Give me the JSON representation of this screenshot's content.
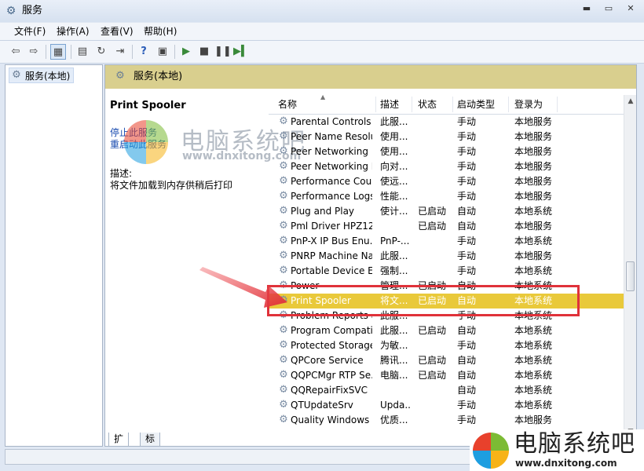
{
  "window": {
    "title": "服务"
  },
  "menu": [
    {
      "label": "文件(F)"
    },
    {
      "label": "操作(A)"
    },
    {
      "label": "查看(V)"
    },
    {
      "label": "帮助(H)"
    }
  ],
  "tree": {
    "root_label": "服务(本地)"
  },
  "panel": {
    "header_title": "服务(本地)"
  },
  "detail": {
    "service_name": "Print Spooler",
    "stop_link": "停止此服务",
    "restart_link": "重启动此服务",
    "description_label": "描述:",
    "description_text": "将文件加载到内存供稍后打印"
  },
  "table": {
    "columns": [
      "名称",
      "描述",
      "状态",
      "启动类型",
      "登录为"
    ],
    "rows": [
      [
        "Parental Controls",
        "此服...",
        "",
        "手动",
        "本地服务"
      ],
      [
        "Peer Name Resolu...",
        "使用...",
        "",
        "手动",
        "本地服务"
      ],
      [
        "Peer Networking ...",
        "使用...",
        "",
        "手动",
        "本地服务"
      ],
      [
        "Peer Networking I...",
        "向对...",
        "",
        "手动",
        "本地服务"
      ],
      [
        "Performance Cou...",
        "使远...",
        "",
        "手动",
        "本地服务"
      ],
      [
        "Performance Logs...",
        "性能...",
        "",
        "手动",
        "本地服务"
      ],
      [
        "Plug and Play",
        "使计...",
        "已启动",
        "自动",
        "本地系统"
      ],
      [
        "Pml Driver HPZ12",
        "",
        "已启动",
        "自动",
        "本地服务"
      ],
      [
        "PnP-X IP Bus Enu...",
        "PnP-...",
        "",
        "手动",
        "本地系统"
      ],
      [
        "PNRP Machine Na...",
        "此服...",
        "",
        "手动",
        "本地服务"
      ],
      [
        "Portable Device E...",
        "强制...",
        "",
        "手动",
        "本地系统"
      ],
      [
        "Power",
        "管理...",
        "已启动",
        "自动",
        "本地系统"
      ],
      [
        "Print Spooler",
        "将文...",
        "已启动",
        "自动",
        "本地系统"
      ],
      [
        "Problem Reports a...",
        "此服...",
        "",
        "手动",
        "本地系统"
      ],
      [
        "Program Compati...",
        "此服...",
        "已启动",
        "自动",
        "本地系统"
      ],
      [
        "Protected Storage",
        "为敏...",
        "",
        "手动",
        "本地系统"
      ],
      [
        "QPCore Service",
        "腾讯...",
        "已启动",
        "自动",
        "本地系统"
      ],
      [
        "QQPCMgr RTP Se...",
        "电脑...",
        "已启动",
        "自动",
        "本地系统"
      ],
      [
        "QQRepairFixSVC",
        "",
        "",
        "自动",
        "本地系统"
      ],
      [
        "QTUpdateSrv",
        "Upda...",
        "",
        "手动",
        "本地系统"
      ],
      [
        "Quality Windows ...",
        "优质...",
        "",
        "手动",
        "本地服务"
      ]
    ],
    "selected_row": 12
  },
  "tabs": [
    "扩展",
    "标准"
  ],
  "watermark": {
    "title": "电脑系统吧",
    "url": "www.dnxitong.com"
  },
  "brand": {
    "title": "电脑系统吧",
    "url": "www.dnxitong.com"
  },
  "colors": {
    "selection": "#e9c93a",
    "highlight_box": "#e0323a",
    "panel_header": "#d9cf8e"
  }
}
